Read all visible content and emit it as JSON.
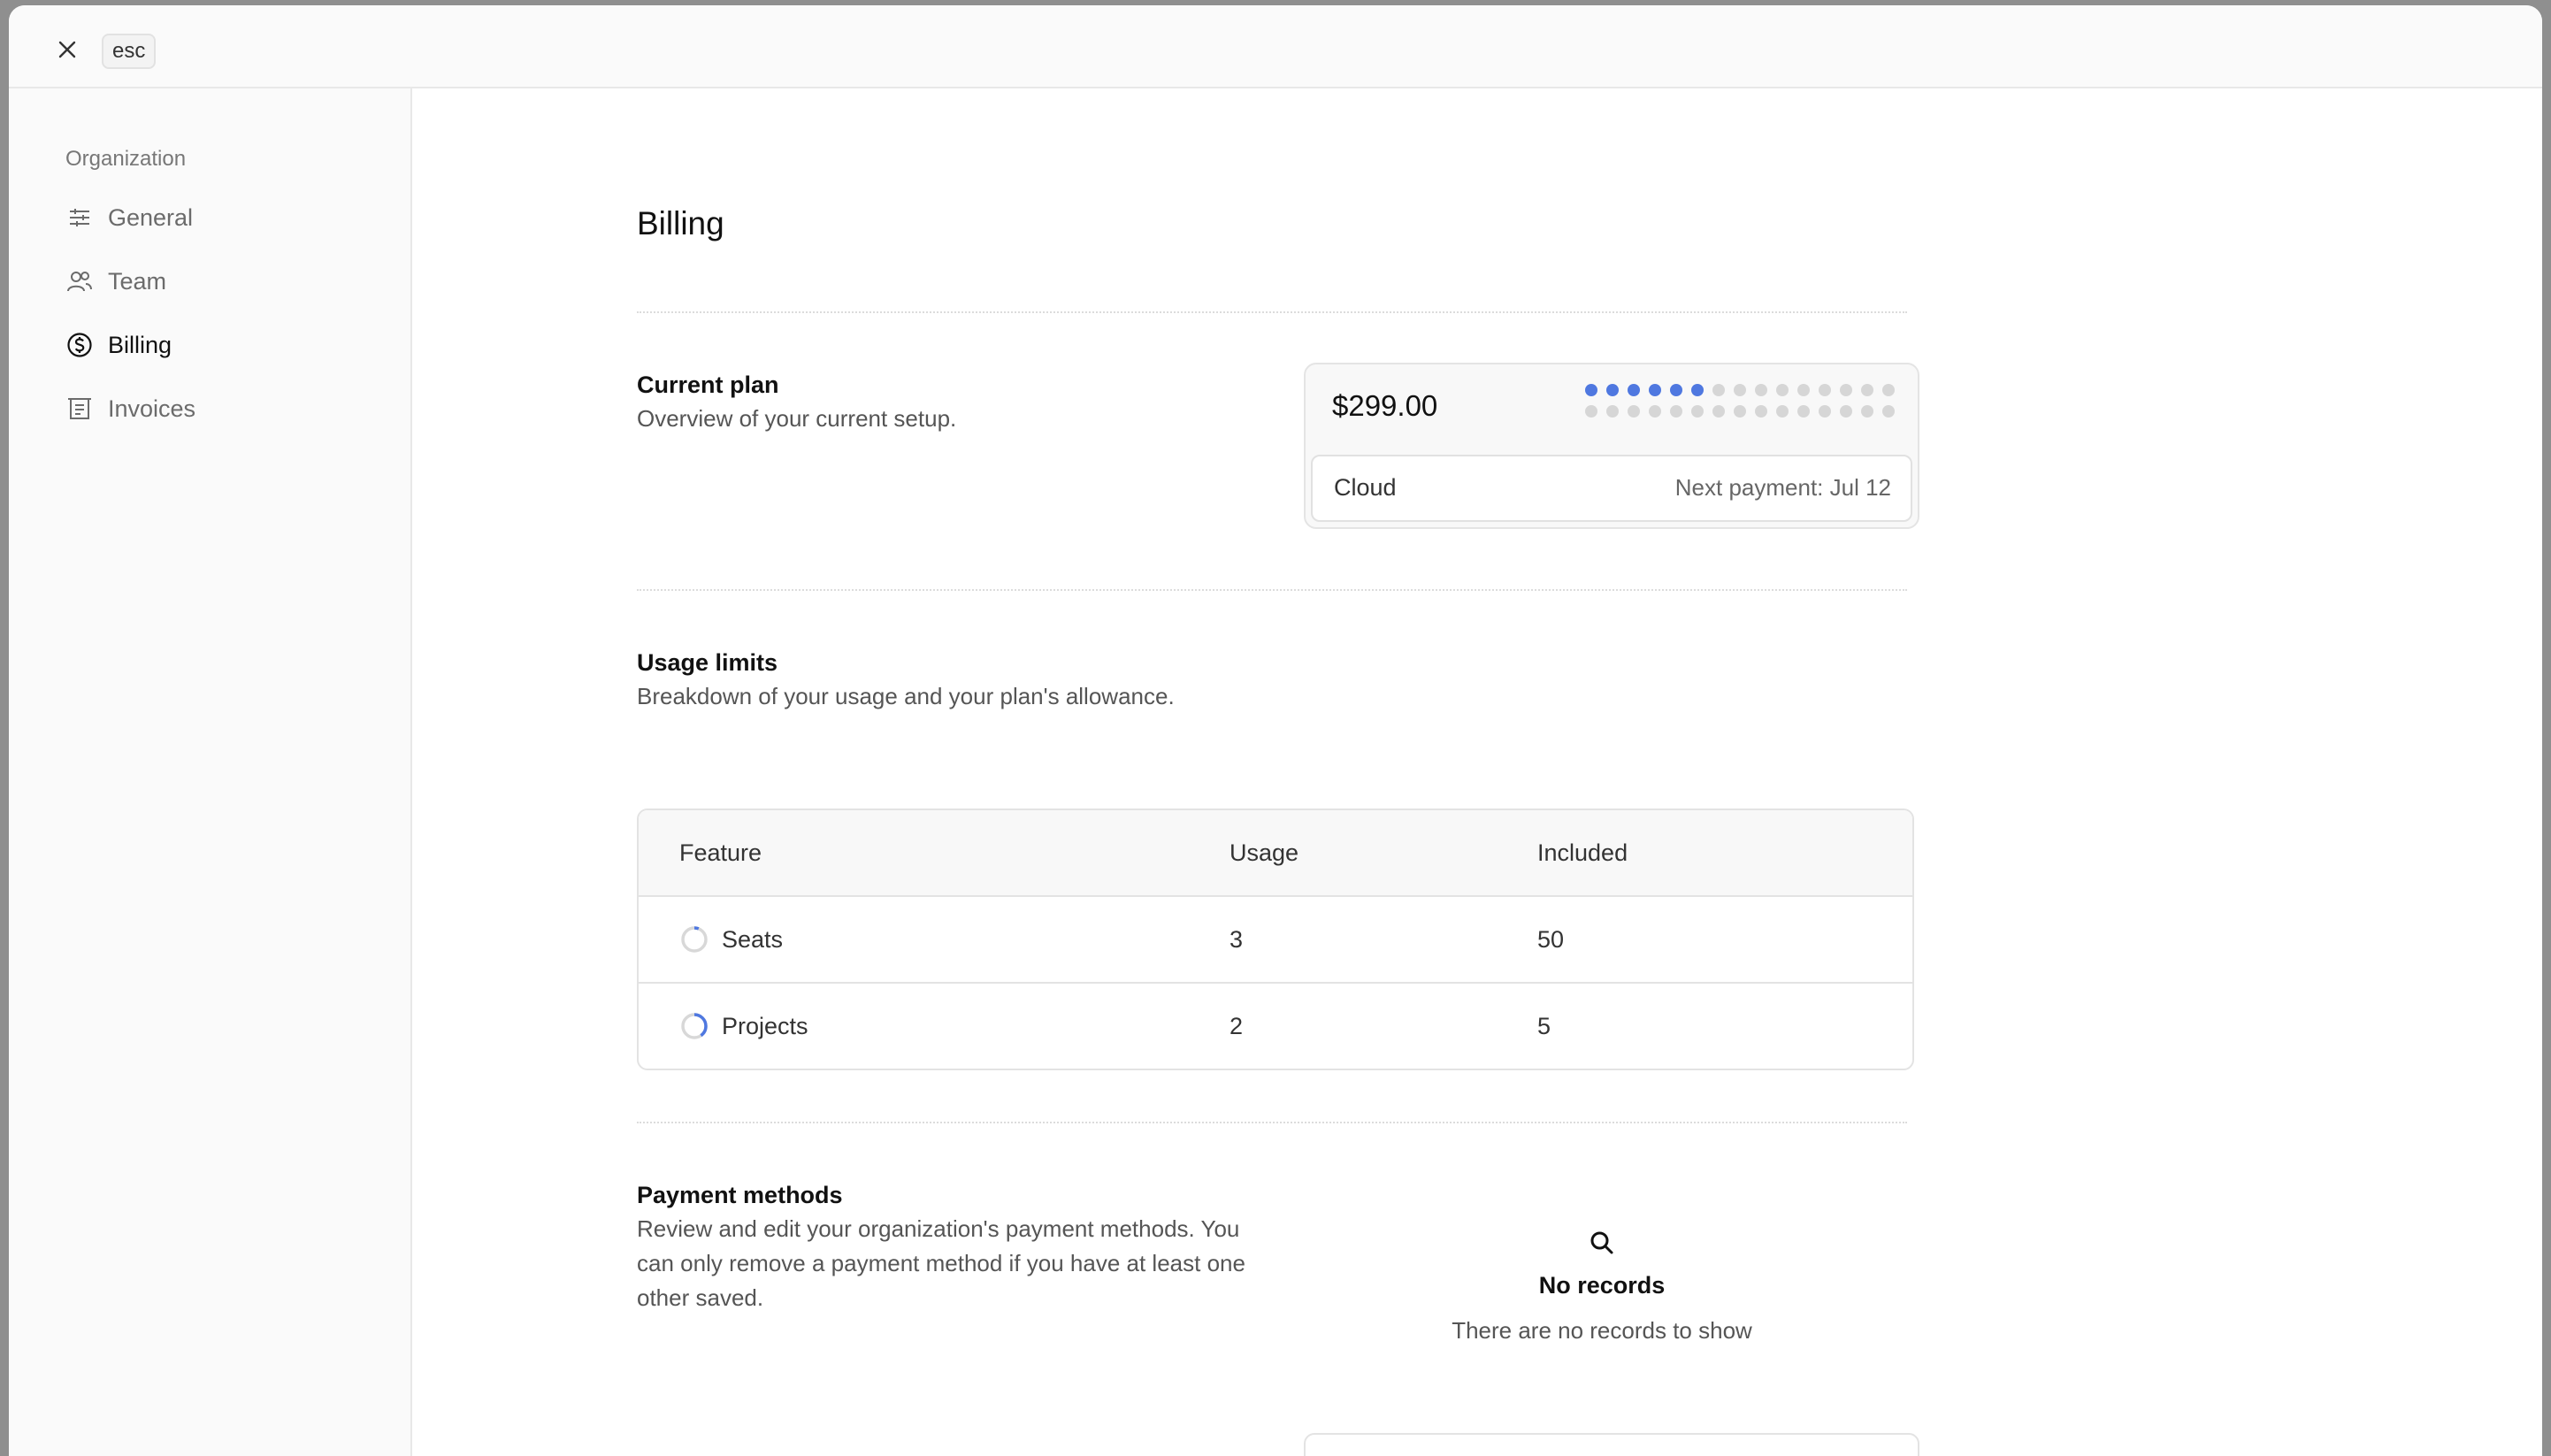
{
  "topbar": {
    "esc_label": "esc"
  },
  "sidebar": {
    "heading": "Organization",
    "items": [
      {
        "label": "General",
        "icon": "sliders-icon",
        "active": false
      },
      {
        "label": "Team",
        "icon": "users-icon",
        "active": false
      },
      {
        "label": "Billing",
        "icon": "dollar-circle-icon",
        "active": true
      },
      {
        "label": "Invoices",
        "icon": "receipt-icon",
        "active": false
      }
    ]
  },
  "page": {
    "title": "Billing"
  },
  "current_plan": {
    "title": "Current plan",
    "description": "Overview of your current setup.",
    "price": "$299.00",
    "plan_name": "Cloud",
    "next_payment": "Next payment: Jul 12",
    "dots_filled": 6,
    "dots_total": 30,
    "accent_color": "#4f78e0"
  },
  "usage_limits": {
    "title": "Usage limits",
    "description": "Breakdown of your usage and your plan's allowance.",
    "columns": [
      "Feature",
      "Usage",
      "Included"
    ],
    "rows": [
      {
        "feature": "Seats",
        "usage": "3",
        "included": "50",
        "ratio": 0.06
      },
      {
        "feature": "Projects",
        "usage": "2",
        "included": "5",
        "ratio": 0.4
      }
    ]
  },
  "payment_methods": {
    "title": "Payment methods",
    "description": "Review and edit your organization's payment methods. You can only remove a payment method if you have at least one other saved.",
    "empty_title": "No records",
    "empty_subtitle": "There are no records to show"
  }
}
